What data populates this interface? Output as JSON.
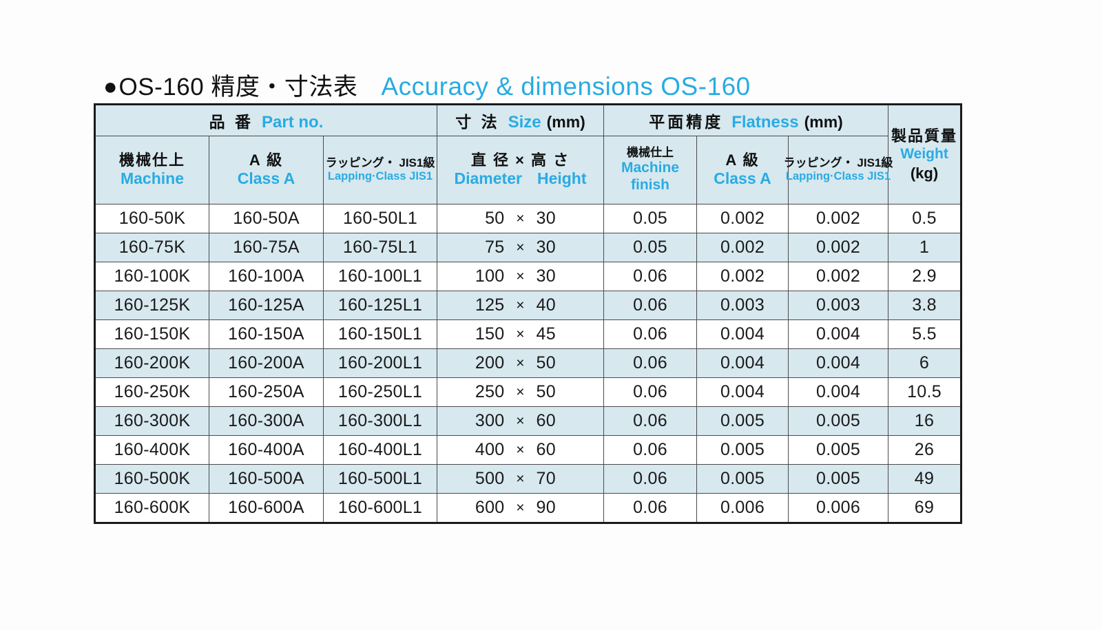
{
  "title": {
    "bullet": "●",
    "jp": "OS-160 精度・寸法表",
    "en": "Accuracy & dimensions OS-160",
    "accent_color": "#29abe2"
  },
  "table": {
    "group_headers": [
      {
        "jp": "品 番",
        "en": "Part no.",
        "unit": "",
        "span": 3
      },
      {
        "jp": "寸 法",
        "en": "Size",
        "unit": "(mm)",
        "span": 1
      },
      {
        "jp": "平面精度",
        "en": "Flatness",
        "unit": "(mm)",
        "span": 3
      }
    ],
    "weight_header": {
      "jp": "製品質量",
      "en": "Weight",
      "unit": "(kg)"
    },
    "sub_headers": [
      {
        "jp": "機械仕上",
        "en": "Machine"
      },
      {
        "jp": "A 級",
        "en": "Class A"
      },
      {
        "jp": "ラッピング・ JIS1級",
        "en": "Lapping·Class JIS1"
      },
      {
        "jp": "直 径 × 高 さ",
        "en_a": "Diameter",
        "en_b": "Height"
      },
      {
        "jp": "機械仕上",
        "en": "Machine",
        "en2": "finish"
      },
      {
        "jp": "A 級",
        "en": "Class A"
      },
      {
        "jp": "ラッピング・ JIS1級",
        "en": "Lapping·Class JIS1"
      }
    ],
    "rows": [
      {
        "machine": "160-50K",
        "class_a": "160-50A",
        "lapping": "160-50L1",
        "diameter": "50",
        "x": "×",
        "height": "30",
        "flat_machine": "0.05",
        "flat_class_a": "0.002",
        "flat_lapping": "0.002",
        "weight": "0.5"
      },
      {
        "machine": "160-75K",
        "class_a": "160-75A",
        "lapping": "160-75L1",
        "diameter": "75",
        "x": "×",
        "height": "30",
        "flat_machine": "0.05",
        "flat_class_a": "0.002",
        "flat_lapping": "0.002",
        "weight": "1"
      },
      {
        "machine": "160-100K",
        "class_a": "160-100A",
        "lapping": "160-100L1",
        "diameter": "100",
        "x": "×",
        "height": "30",
        "flat_machine": "0.06",
        "flat_class_a": "0.002",
        "flat_lapping": "0.002",
        "weight": "2.9"
      },
      {
        "machine": "160-125K",
        "class_a": "160-125A",
        "lapping": "160-125L1",
        "diameter": "125",
        "x": "×",
        "height": "40",
        "flat_machine": "0.06",
        "flat_class_a": "0.003",
        "flat_lapping": "0.003",
        "weight": "3.8"
      },
      {
        "machine": "160-150K",
        "class_a": "160-150A",
        "lapping": "160-150L1",
        "diameter": "150",
        "x": "×",
        "height": "45",
        "flat_machine": "0.06",
        "flat_class_a": "0.004",
        "flat_lapping": "0.004",
        "weight": "5.5"
      },
      {
        "machine": "160-200K",
        "class_a": "160-200A",
        "lapping": "160-200L1",
        "diameter": "200",
        "x": "×",
        "height": "50",
        "flat_machine": "0.06",
        "flat_class_a": "0.004",
        "flat_lapping": "0.004",
        "weight": "6"
      },
      {
        "machine": "160-250K",
        "class_a": "160-250A",
        "lapping": "160-250L1",
        "diameter": "250",
        "x": "×",
        "height": "50",
        "flat_machine": "0.06",
        "flat_class_a": "0.004",
        "flat_lapping": "0.004",
        "weight": "10.5"
      },
      {
        "machine": "160-300K",
        "class_a": "160-300A",
        "lapping": "160-300L1",
        "diameter": "300",
        "x": "×",
        "height": "60",
        "flat_machine": "0.06",
        "flat_class_a": "0.005",
        "flat_lapping": "0.005",
        "weight": "16"
      },
      {
        "machine": "160-400K",
        "class_a": "160-400A",
        "lapping": "160-400L1",
        "diameter": "400",
        "x": "×",
        "height": "60",
        "flat_machine": "0.06",
        "flat_class_a": "0.005",
        "flat_lapping": "0.005",
        "weight": "26"
      },
      {
        "machine": "160-500K",
        "class_a": "160-500A",
        "lapping": "160-500L1",
        "diameter": "500",
        "x": "×",
        "height": "70",
        "flat_machine": "0.06",
        "flat_class_a": "0.005",
        "flat_lapping": "0.005",
        "weight": "49"
      },
      {
        "machine": "160-600K",
        "class_a": "160-600A",
        "lapping": "160-600L1",
        "diameter": "600",
        "x": "×",
        "height": "90",
        "flat_machine": "0.06",
        "flat_class_a": "0.006",
        "flat_lapping": "0.006",
        "weight": "69"
      }
    ],
    "colors": {
      "header_bg": "#d7e8ef",
      "alt_row_bg": "#d7e8ef",
      "row_bg": "#ffffff",
      "border": "#1a1a1a",
      "text": "#1a1a1a"
    }
  }
}
